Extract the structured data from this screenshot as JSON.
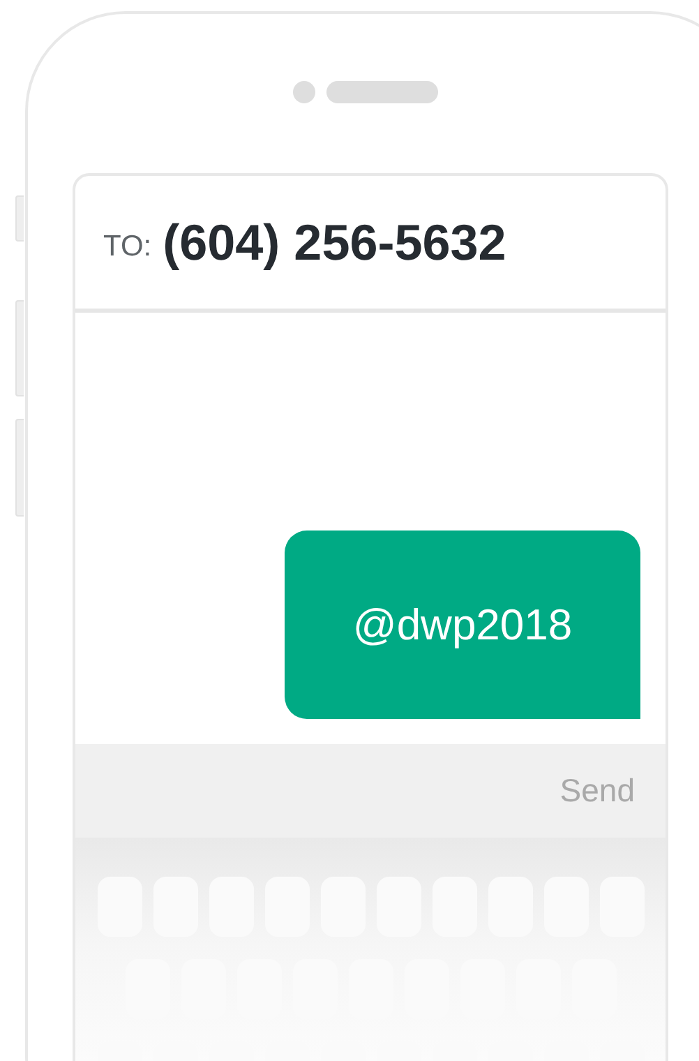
{
  "header": {
    "to_label": "TO:",
    "recipient": "(604) 256-5632"
  },
  "bubbles": [
    {
      "kind": "outgoing",
      "text": "@dwp2018"
    }
  ],
  "send_button": {
    "label": "Send"
  }
}
